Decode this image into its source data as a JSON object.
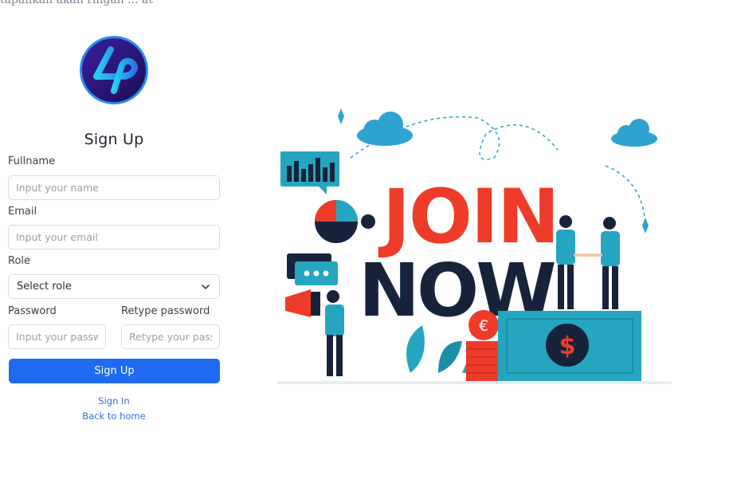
{
  "top_text": "tapahkan akan ringan ... at",
  "form": {
    "title": "Sign Up",
    "fullname_label": "Fullname",
    "fullname_placeholder": "Input your name",
    "email_label": "Email",
    "email_placeholder": "Input your email",
    "role_label": "Role",
    "role_selected": "Select role",
    "password_label": "Password",
    "password_placeholder": "Input your password",
    "retype_label": "Retype password",
    "retype_placeholder": "Retype your password",
    "submit_label": "Sign Up",
    "signin_link": "Sign In",
    "home_link": "Back to home"
  },
  "illustration": {
    "headline_1": "JOIN",
    "headline_2": "NOW",
    "currency_1": "$",
    "currency_2": "€"
  },
  "colors": {
    "primary": "#1f6bf0",
    "headline_red": "#ee3b2a",
    "headline_dark": "#17233a",
    "teal": "#25a5c0"
  }
}
